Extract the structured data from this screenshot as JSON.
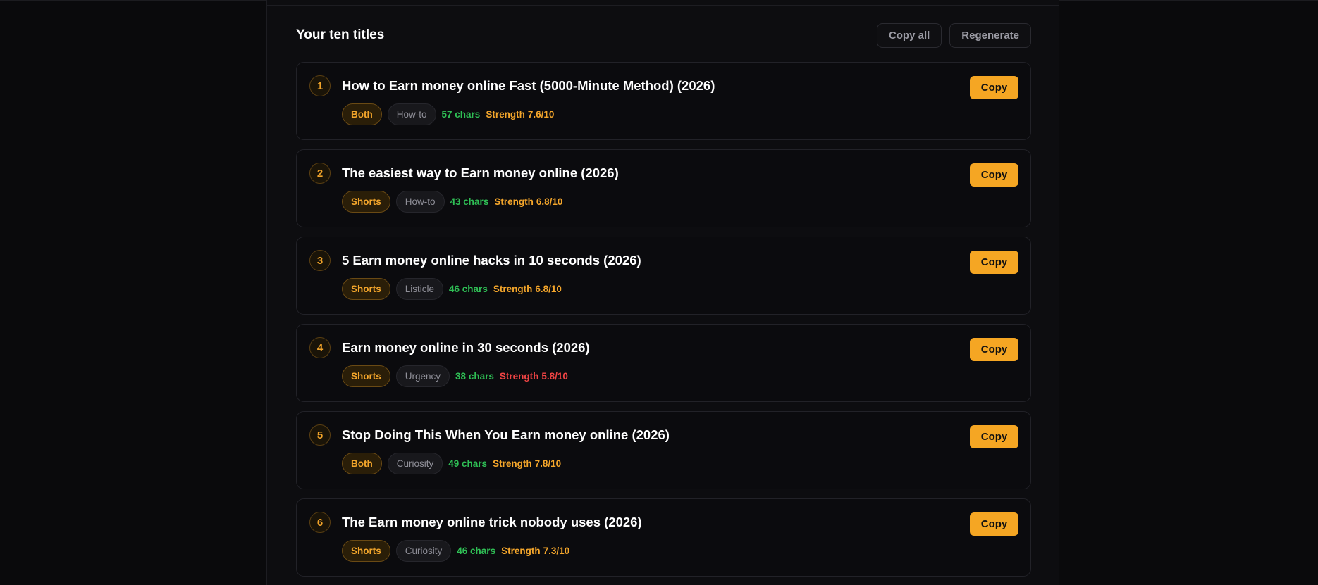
{
  "header": {
    "title": "Your ten titles",
    "copy_all_label": "Copy all",
    "regenerate_label": "Regenerate"
  },
  "strength_prefix": "Strength",
  "titles": [
    {
      "number": "1",
      "title": "How to Earn money online Fast (5000-Minute Method) (2026)",
      "format": "Both",
      "style": "How-to",
      "chars": "57 chars",
      "strength": "7.6/10",
      "strength_level": "high",
      "copy_label": "Copy"
    },
    {
      "number": "2",
      "title": "The easiest way to Earn money online (2026)",
      "format": "Shorts",
      "style": "How-to",
      "chars": "43 chars",
      "strength": "6.8/10",
      "strength_level": "high",
      "copy_label": "Copy"
    },
    {
      "number": "3",
      "title": "5 Earn money online hacks in 10 seconds (2026)",
      "format": "Shorts",
      "style": "Listicle",
      "chars": "46 chars",
      "strength": "6.8/10",
      "strength_level": "high",
      "copy_label": "Copy"
    },
    {
      "number": "4",
      "title": "Earn money online in 30 seconds (2026)",
      "format": "Shorts",
      "style": "Urgency",
      "chars": "38 chars",
      "strength": "5.8/10",
      "strength_level": "low",
      "copy_label": "Copy"
    },
    {
      "number": "5",
      "title": "Stop Doing This When You Earn money online (2026)",
      "format": "Both",
      "style": "Curiosity",
      "chars": "49 chars",
      "strength": "7.8/10",
      "strength_level": "high",
      "copy_label": "Copy"
    },
    {
      "number": "6",
      "title": "The Earn money online trick nobody uses (2026)",
      "format": "Shorts",
      "style": "Curiosity",
      "chars": "46 chars",
      "strength": "7.3/10",
      "strength_level": "high",
      "copy_label": "Copy"
    }
  ],
  "colors": {
    "accent": "#f5a623",
    "chars_ok": "#2fbf55",
    "strength_high": "#f4a62b",
    "strength_low": "#ef4444",
    "background": "#0a0a0c"
  }
}
